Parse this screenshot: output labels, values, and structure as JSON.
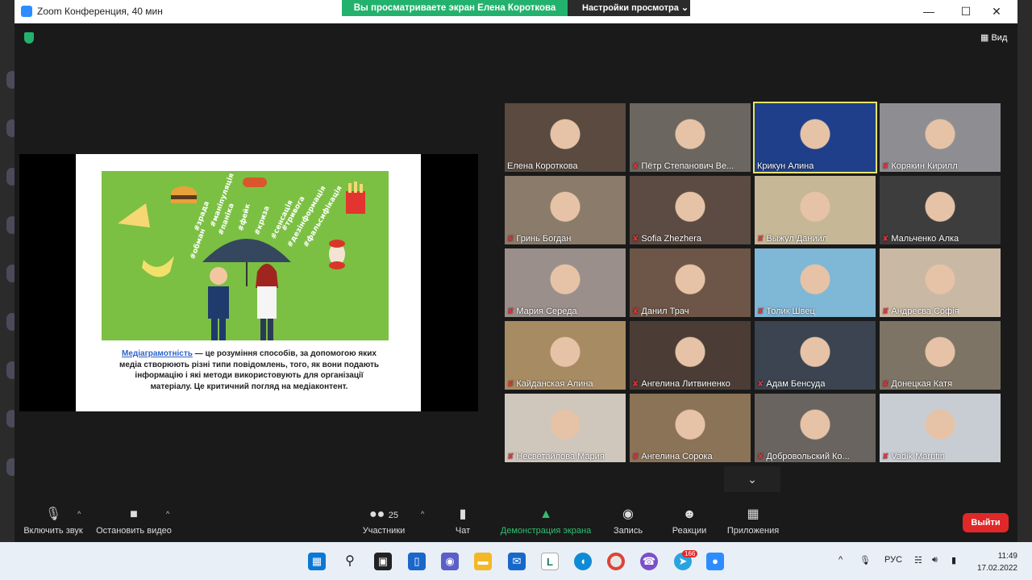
{
  "titlebar": {
    "title": "Zoom Конференция, 40 мин",
    "share_banner": "Вы просматриваете экран Елена Короткова",
    "view_settings": "Настройки просмотра"
  },
  "view_button": "Вид",
  "slide": {
    "term": "Медіаграмотність",
    "text": " — це розуміння способів, за допомогою яких медіа створюють різні типи повідомлень, того, як вони подають інформацію і які методи використовують для організації матеріалу. Це критичний погляд на медіаконтент.",
    "hashtags": [
      "#маніпуляція",
      "#фейк",
      "#криза",
      "#сенсація",
      "#дезінформація",
      "#зрада",
      "#паніка",
      "#тривога",
      "#фальсифікація",
      "#обман"
    ]
  },
  "participants": [
    {
      "name": "Елена Короткова",
      "muted": false,
      "bg": "#5a4a3f"
    },
    {
      "name": "Пётр Степанович Ве...",
      "muted": true,
      "bg": "#6b6660"
    },
    {
      "name": "Крикун Алина",
      "muted": false,
      "bg": "#1f3f8a",
      "active": true
    },
    {
      "name": "Корякин Кирилл",
      "muted": true,
      "bg": "#8e8e92"
    },
    {
      "name": "Гринь Богдан",
      "muted": true,
      "bg": "#8a7b6a"
    },
    {
      "name": "Sofia Zhezhera",
      "muted": true,
      "bg": "#5c4b42"
    },
    {
      "name": "Выжул Даниил",
      "muted": true,
      "bg": "#c6b796"
    },
    {
      "name": "Мальченко Алка",
      "muted": true,
      "bg": "#3d3d3d"
    },
    {
      "name": "Мария Середа",
      "muted": true,
      "bg": "#9a8f8a"
    },
    {
      "name": "Данил Трач",
      "muted": true,
      "bg": "#6d5647"
    },
    {
      "name": "Толик Швец",
      "muted": true,
      "bg": "#7fb7d6"
    },
    {
      "name": "Андреєва Софія",
      "muted": true,
      "bg": "#c9b8a4"
    },
    {
      "name": "Кайданская Алина",
      "muted": true,
      "bg": "#a78b63"
    },
    {
      "name": "Ангелина Литвиненко",
      "muted": true,
      "bg": "#4b3d36"
    },
    {
      "name": "Адам Бенсуда",
      "muted": true,
      "bg": "#3b4450"
    },
    {
      "name": "Донецкая Катя",
      "muted": true,
      "bg": "#7d7466"
    },
    {
      "name": "Несветайлова Мария",
      "muted": true,
      "bg": "#cfc6bc"
    },
    {
      "name": "Ангелина Сорока",
      "muted": true,
      "bg": "#8b7358"
    },
    {
      "name": "Добровольский Ко...",
      "muted": true,
      "bg": "#6a6460"
    },
    {
      "name": "Vadik Marutin",
      "muted": true,
      "bg": "#c8cdd4"
    }
  ],
  "toolbar": {
    "unmute": "Включить звук",
    "stop_video": "Остановить видео",
    "participants": "Участники",
    "participants_count": "25",
    "chat": "Чат",
    "share": "Демонстрация экрана",
    "record": "Запись",
    "reactions": "Реакции",
    "apps": "Приложения",
    "leave": "Выйти"
  },
  "taskbar": {
    "lang": "РУС",
    "time": "11:49",
    "date": "17.02.2022",
    "badge": "166"
  },
  "colors": {
    "accent_green": "#23b26d",
    "leave_red": "#e02828",
    "active_speaker": "#e8e36a"
  }
}
